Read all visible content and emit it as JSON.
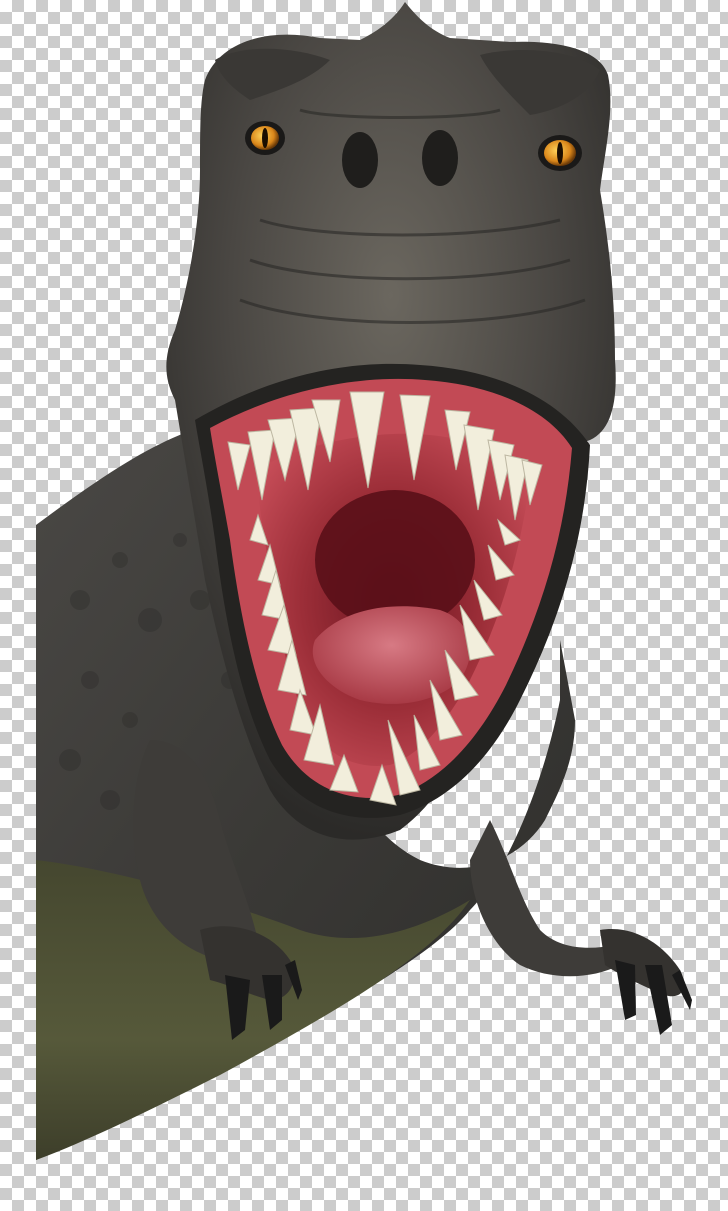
{
  "image": {
    "subject": "t-rex",
    "background": "transparency-checkerboard",
    "colors": {
      "checker_light": "#ffffff",
      "checker_dark": "#cccccc",
      "skin_dark": "#3b3936",
      "skin_mid": "#55524c",
      "skin_light": "#77736a",
      "belly": "#4e5235",
      "mouth_inner": "#a8343f",
      "gum": "#c24a55",
      "throat": "#5a1018",
      "tooth": "#f2eedc",
      "eye": "#e8a320",
      "claw": "#1a1a1a"
    }
  }
}
